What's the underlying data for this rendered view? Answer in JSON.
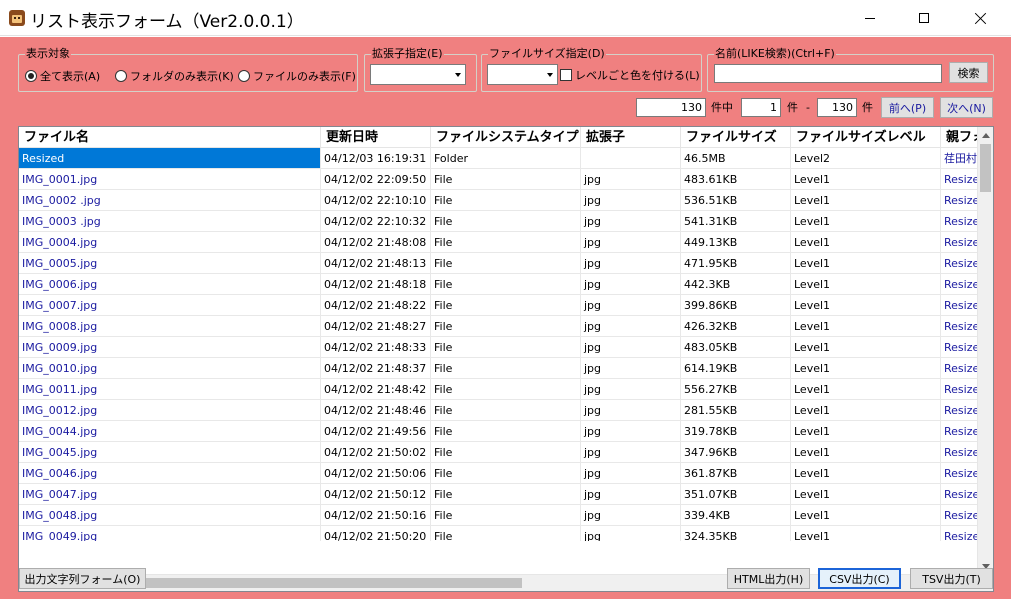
{
  "window": {
    "title": "リスト表示フォーム（Ver2.0.0.1）",
    "icon": "app-icon"
  },
  "display_target": {
    "legend": "表示対象",
    "options": [
      "全て表示(A)",
      "フォルダのみ表示(K)",
      "ファイルのみ表示(F)"
    ],
    "selected_index": 0
  },
  "extension_filter": {
    "legend": "拡張子指定(E)",
    "value": ""
  },
  "size_filter": {
    "legend": "ファイルサイズ指定(D)",
    "value": "",
    "color_by_level_label": "レベルごと色を付ける(L)",
    "color_by_level_checked": false
  },
  "name_search": {
    "legend": "名前(LIKE検索)(Ctrl+F)",
    "value": "",
    "search_button": "検索"
  },
  "paging": {
    "total": "130",
    "of_label": "件中",
    "from": "1",
    "from_label": "件",
    "dash": "-",
    "to": "130",
    "to_label": "件",
    "prev_button": "前へ(P)",
    "next_button": "次へ(N)"
  },
  "table": {
    "columns": [
      "ファイル名",
      "更新日時",
      "ファイルシステムタイプ",
      "拡張子",
      "ファイルサイズ",
      "ファイルサイズレベル",
      "親フォ"
    ],
    "rows": [
      [
        "Resized",
        "04/12/03 16:19:31",
        "Folder",
        "",
        "46.5MB",
        "Level2",
        "荏田村"
      ],
      [
        "IMG_0001.jpg",
        "04/12/02 22:09:50",
        "File",
        "jpg",
        "483.61KB",
        "Level1",
        "Resize"
      ],
      [
        "IMG_0002 .jpg",
        "04/12/02 22:10:10",
        "File",
        "jpg",
        "536.51KB",
        "Level1",
        "Resize"
      ],
      [
        "IMG_0003 .jpg",
        "04/12/02 22:10:32",
        "File",
        "jpg",
        "541.31KB",
        "Level1",
        "Resize"
      ],
      [
        "IMG_0004.jpg",
        "04/12/02 21:48:08",
        "File",
        "jpg",
        "449.13KB",
        "Level1",
        "Resize"
      ],
      [
        "IMG_0005.jpg",
        "04/12/02 21:48:13",
        "File",
        "jpg",
        "471.95KB",
        "Level1",
        "Resize"
      ],
      [
        "IMG_0006.jpg",
        "04/12/02 21:48:18",
        "File",
        "jpg",
        "442.3KB",
        "Level1",
        "Resize"
      ],
      [
        "IMG_0007.jpg",
        "04/12/02 21:48:22",
        "File",
        "jpg",
        "399.86KB",
        "Level1",
        "Resize"
      ],
      [
        "IMG_0008.jpg",
        "04/12/02 21:48:27",
        "File",
        "jpg",
        "426.32KB",
        "Level1",
        "Resize"
      ],
      [
        "IMG_0009.jpg",
        "04/12/02 21:48:33",
        "File",
        "jpg",
        "483.05KB",
        "Level1",
        "Resize"
      ],
      [
        "IMG_0010.jpg",
        "04/12/02 21:48:37",
        "File",
        "jpg",
        "614.19KB",
        "Level1",
        "Resize"
      ],
      [
        "IMG_0011.jpg",
        "04/12/02 21:48:42",
        "File",
        "jpg",
        "556.27KB",
        "Level1",
        "Resize"
      ],
      [
        "IMG_0012.jpg",
        "04/12/02 21:48:46",
        "File",
        "jpg",
        "281.55KB",
        "Level1",
        "Resize"
      ],
      [
        "IMG_0044.jpg",
        "04/12/02 21:49:56",
        "File",
        "jpg",
        "319.78KB",
        "Level1",
        "Resize"
      ],
      [
        "IMG_0045.jpg",
        "04/12/02 21:50:02",
        "File",
        "jpg",
        "347.96KB",
        "Level1",
        "Resize"
      ],
      [
        "IMG_0046.jpg",
        "04/12/02 21:50:06",
        "File",
        "jpg",
        "361.87KB",
        "Level1",
        "Resize"
      ],
      [
        "IMG_0047.jpg",
        "04/12/02 21:50:12",
        "File",
        "jpg",
        "351.07KB",
        "Level1",
        "Resize"
      ],
      [
        "IMG_0048.jpg",
        "04/12/02 21:50:16",
        "File",
        "jpg",
        "339.4KB",
        "Level1",
        "Resize"
      ],
      [
        "IMG_0049.jpg",
        "04/12/02 21:50:20",
        "File",
        "jpg",
        "324.35KB",
        "Level1",
        "Resize"
      ]
    ],
    "selected_row": 0
  },
  "footer": {
    "output_string_form_button": "出力文字列フォーム(O)",
    "html_button": "HTML出力(H)",
    "csv_button": "CSV出力(C)",
    "tsv_button": "TSV出力(T)"
  },
  "colors": {
    "client_background": "#f08080",
    "selection": "#0078d7",
    "link_text": "#1a1aa0",
    "focus_border": "#1c64d8"
  }
}
